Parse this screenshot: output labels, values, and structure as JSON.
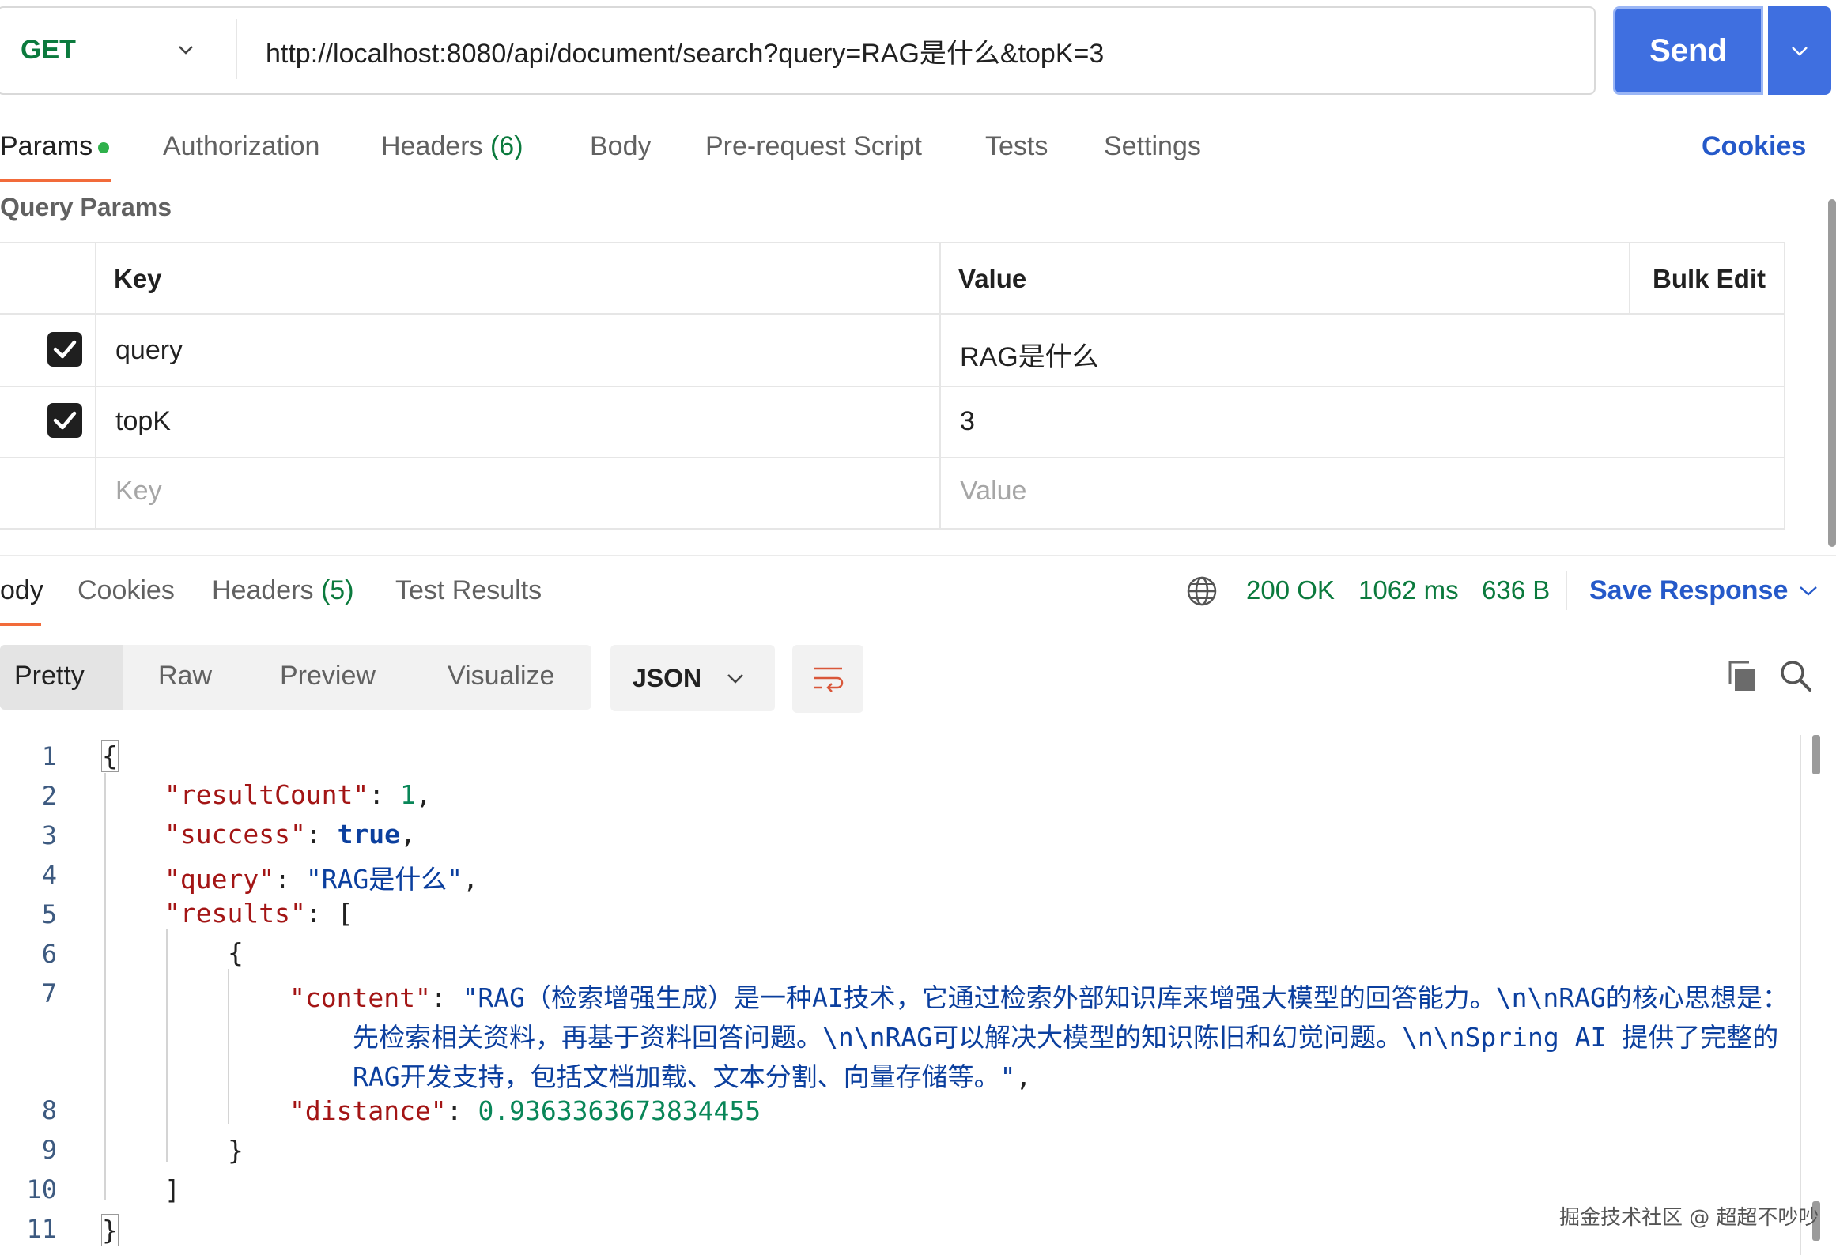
{
  "request": {
    "method": "GET",
    "url": "http://localhost:8080/api/document/search?query=RAG是什么&topK=3",
    "send_label": "Send"
  },
  "request_tabs": [
    {
      "label": "Params",
      "count": ""
    },
    {
      "label": "Authorization",
      "count": ""
    },
    {
      "label": "Headers",
      "count": "(6)"
    },
    {
      "label": "Body",
      "count": ""
    },
    {
      "label": "Pre-request Script",
      "count": ""
    },
    {
      "label": "Tests",
      "count": ""
    },
    {
      "label": "Settings",
      "count": ""
    }
  ],
  "cookies_link": "Cookies",
  "query_params": {
    "title": "Query Params",
    "headers": {
      "key": "Key",
      "value": "Value",
      "bulk_edit": "Bulk Edit"
    },
    "rows": [
      {
        "checked": true,
        "key": "query",
        "value": "RAG是什么"
      },
      {
        "checked": true,
        "key": "topK",
        "value": "3"
      }
    ],
    "placeholder": {
      "key": "Key",
      "value": "Value"
    }
  },
  "response_tabs": [
    {
      "label": "ody",
      "count": ""
    },
    {
      "label": "Cookies",
      "count": ""
    },
    {
      "label": "Headers",
      "count": "(5)"
    },
    {
      "label": "Test Results",
      "count": ""
    }
  ],
  "status": {
    "code": "200 OK",
    "time": "1062 ms",
    "size": "636 B"
  },
  "save_response": "Save Response",
  "view_modes": [
    "Pretty",
    "Raw",
    "Preview",
    "Visualize"
  ],
  "format": "JSON",
  "code": {
    "line_numbers": [
      "1",
      "2",
      "3",
      "4",
      "5",
      "6",
      "7",
      "8",
      "9",
      "10",
      "11"
    ],
    "open_brace": "{",
    "close_brace": "}",
    "result_count_key": "\"resultCount\"",
    "result_count_val": "1",
    "success_key": "\"success\"",
    "success_val": "true",
    "query_key": "\"query\"",
    "query_val": "\"RAG是什么\"",
    "results_key": "\"results\"",
    "open_bracket": "[",
    "close_bracket": "]",
    "content_key": "\"content\"",
    "content_line1": "\"RAG（检索增强生成）是一种AI技术，它通过检索外部知识库来增强大模型的回答能力。\\n\\nRAG的核心思想是：",
    "content_line2": "先检索相关资料，再基于资料回答问题。\\n\\nRAG可以解决大模型的知识陈旧和幻觉问题。\\n\\nSpring AI 提供了完整的",
    "content_line3": "RAG开发支持，包括文档加载、文本分割、向量存储等。\"",
    "distance_key": "\"distance\"",
    "distance_val": "0.9363363673834455"
  },
  "watermark": "掘金技术社区 @ 超超不吵吵"
}
